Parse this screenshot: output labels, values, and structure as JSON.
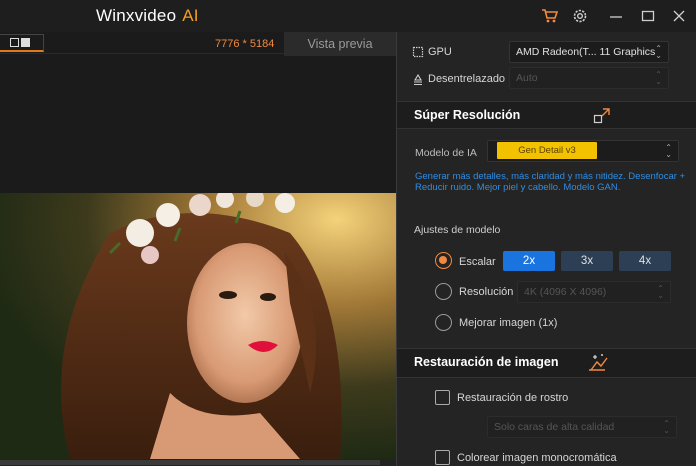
{
  "titlebar": {
    "app_name": "Winxvideo",
    "app_suffix": "AI",
    "icons": [
      "cart-icon",
      "gear-icon",
      "minimize-icon",
      "maximize-icon",
      "close-icon"
    ]
  },
  "left_pane": {
    "resolution": "7776 * 5184",
    "preview_tab": "Vista previa"
  },
  "right_pane": {
    "gpu_label": "GPU",
    "gpu_value": "AMD Radeon(T... 11 Graphics",
    "deinterlace_label": "Desentrelazado",
    "deinterlace_value": "Auto",
    "super_resolution": {
      "title": "Súper Resolución",
      "model_label": "Modelo de IA",
      "model_value": "Gen Detail v3",
      "description": "Generar más detalles, más claridad y más nitidez. Desenfocar + Reducir ruido. Mejor piel y cabello. Modelo GAN.",
      "settings_label": "Ajustes de modelo",
      "scale_label": "Escalar",
      "scale_options": [
        "2x",
        "3x",
        "4x"
      ],
      "scale_selected": "2x",
      "resolution_label": "Resolución",
      "resolution_value": "4K (4096 X 4096)",
      "improve_label": "Mejorar imagen (1x)"
    },
    "restoration": {
      "title": "Restauración de imagen",
      "face_label": "Restauración de rostro",
      "face_option": "Solo caras de alta calidad",
      "colorize_label": "Colorear imagen monocromática"
    }
  },
  "colors": {
    "accent_orange": "#f08a40",
    "accent_blue": "#1a74e0",
    "badge_yellow": "#f2c200",
    "desc_blue": "#2f8de4"
  }
}
